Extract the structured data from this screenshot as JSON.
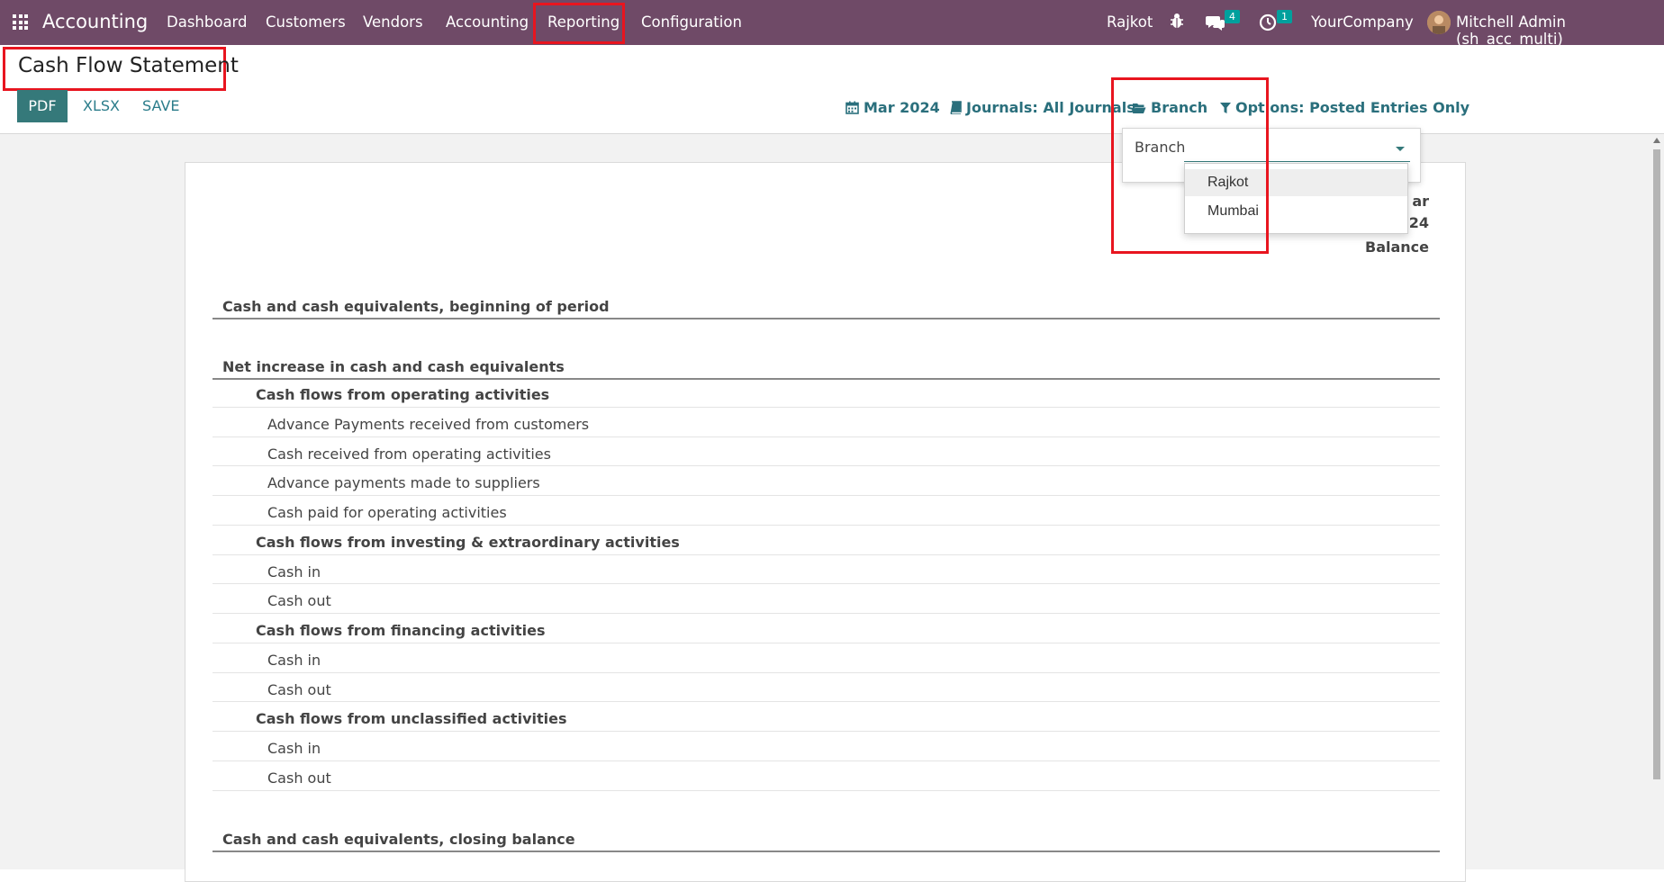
{
  "navbar": {
    "brand": "Accounting",
    "menu": [
      "Dashboard",
      "Customers",
      "Vendors",
      "Accounting",
      "Reporting",
      "Configuration"
    ],
    "branch": "Rajkot",
    "messages_count": "4",
    "activities_count": "1",
    "company": "YourCompany",
    "user": "Mitchell Admin (sh_acc_multi)"
  },
  "control_panel": {
    "title": "Cash Flow Statement",
    "buttons": {
      "pdf": "PDF",
      "xlsx": "XLSX",
      "save": "SAVE"
    },
    "filters": {
      "date": "Mar 2024",
      "journals": "Journals: All Journals",
      "branch": "Branch",
      "options": "Options: Posted Entries Only"
    }
  },
  "branch_dropdown": {
    "label": "Branch",
    "value": "",
    "options": [
      "Rajkot",
      "Mumbai"
    ]
  },
  "report": {
    "column_header": {
      "line1": "ar",
      "line2": "24",
      "line3": "Balance"
    },
    "rows": [
      {
        "level": "section",
        "label": "Cash and cash equivalents, beginning of period"
      },
      {
        "level": "section",
        "label": "Net increase in cash and cash equivalents"
      },
      {
        "level": "sub",
        "label": "Cash flows from operating activities"
      },
      {
        "level": "item",
        "label": "Advance Payments received from customers"
      },
      {
        "level": "item",
        "label": "Cash received from operating activities"
      },
      {
        "level": "item",
        "label": "Advance payments made to suppliers"
      },
      {
        "level": "item",
        "label": "Cash paid for operating activities"
      },
      {
        "level": "sub",
        "label": "Cash flows from investing & extraordinary activities"
      },
      {
        "level": "item",
        "label": "Cash in"
      },
      {
        "level": "item",
        "label": "Cash out"
      },
      {
        "level": "sub",
        "label": "Cash flows from financing activities"
      },
      {
        "level": "item",
        "label": "Cash in"
      },
      {
        "level": "item",
        "label": "Cash out"
      },
      {
        "level": "sub",
        "label": "Cash flows from unclassified activities"
      },
      {
        "level": "item",
        "label": "Cash in"
      },
      {
        "level": "item",
        "label": "Cash out"
      },
      {
        "level": "section",
        "label": "Cash and cash equivalents, closing balance"
      }
    ]
  }
}
